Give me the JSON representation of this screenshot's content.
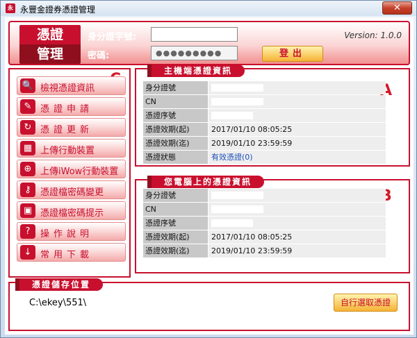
{
  "window": {
    "title": "永豐金證券憑證管理",
    "close": "✕"
  },
  "header": {
    "logo_top": "憑證",
    "logo_bottom": "管理",
    "id_label": "身分證字號:",
    "password_label": "密碼:",
    "password_value": "●●●●●●●●●",
    "logout_label": "登出",
    "version": "Version: 1.0.0"
  },
  "markers": {
    "a": "A",
    "b": "B",
    "c": "C"
  },
  "menu": {
    "items": [
      {
        "label": "檢視憑證資訊",
        "icon": "magnifier-icon",
        "glyph": "🔍",
        "spaced": false
      },
      {
        "label": "憑證申請",
        "icon": "document-icon",
        "glyph": "✎",
        "spaced": true
      },
      {
        "label": "憑證更新",
        "icon": "refresh-icon",
        "glyph": "↻",
        "spaced": true
      },
      {
        "label": "上傳行動裝置",
        "icon": "calculator-icon",
        "glyph": "▦",
        "spaced": false
      },
      {
        "label": "上傳iWow行動裝置",
        "icon": "globe-upload-icon",
        "glyph": "⊕",
        "spaced": false
      },
      {
        "label": "憑證檔密碼變更",
        "icon": "key-icon",
        "glyph": "⚷",
        "spaced": false
      },
      {
        "label": "憑證檔密碼提示",
        "icon": "briefcase-icon",
        "glyph": "▣",
        "spaced": false
      },
      {
        "label": "操作說明",
        "icon": "help-icon",
        "glyph": "?",
        "spaced": true
      },
      {
        "label": "常用下載",
        "icon": "download-icon",
        "glyph": "↓",
        "spaced": true
      }
    ]
  },
  "server_cert": {
    "title": "主機端憑證資訊",
    "rows": [
      {
        "label": "身分證號",
        "value": ""
      },
      {
        "label": "CN",
        "value": ""
      },
      {
        "label": "憑證序號",
        "value": ""
      },
      {
        "label": "憑證效期(起)",
        "value": "2017/01/10 08:05:25"
      },
      {
        "label": "憑證效期(迄)",
        "value": "2019/01/10 23:59:59"
      },
      {
        "label": "憑證狀態",
        "value": "有效憑證(0)"
      }
    ]
  },
  "local_cert": {
    "title": "您電腦上的憑證資訊",
    "rows": [
      {
        "label": "身分證號",
        "value": ""
      },
      {
        "label": "CN",
        "value": ""
      },
      {
        "label": "憑證序號",
        "value": ""
      },
      {
        "label": "憑證效期(起)",
        "value": "2017/01/10 08:05:25"
      },
      {
        "label": "憑證效期(迄)",
        "value": "2019/01/10 23:59:59"
      }
    ]
  },
  "storage": {
    "title": "憑證儲存位置",
    "path": "C:\\ekey\\551\\",
    "choose_label": "自行選取憑證"
  }
}
